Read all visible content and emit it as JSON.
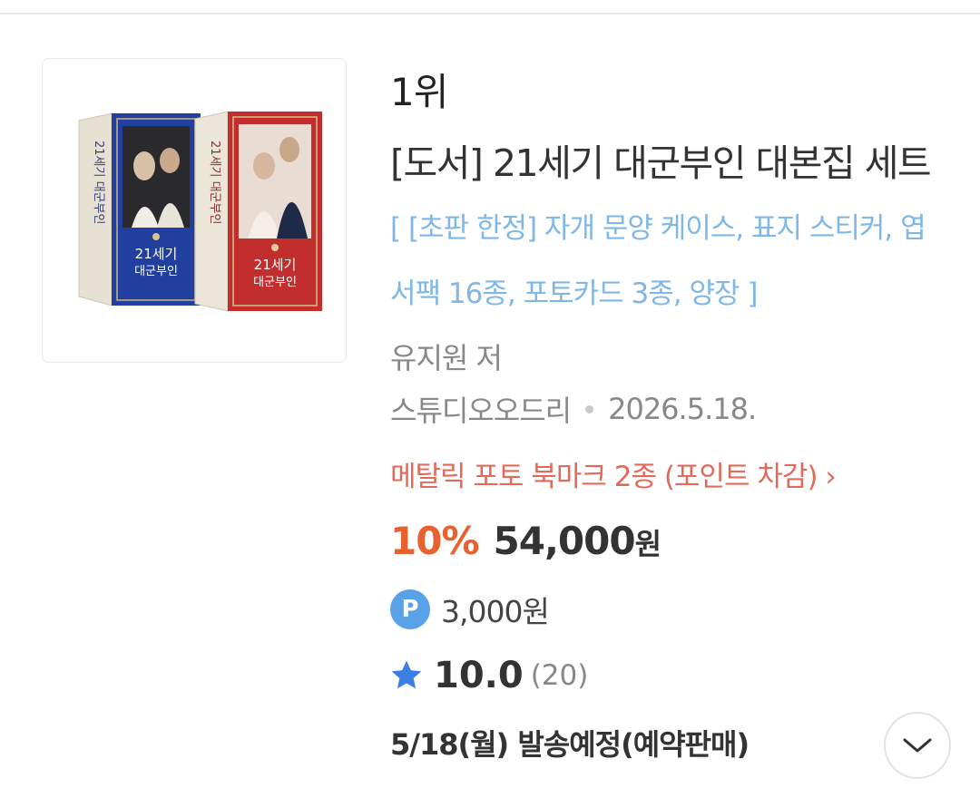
{
  "product": {
    "rank": "1위",
    "title": "[도서] 21세기 대군부인 대본집 세트",
    "subtitle": "[ [초판 한정] 자개 문양 케이스, 표지 스티커, 엽서팩 16종, 포토카드 3종, 양장 ]",
    "cover_text_blue": "21세기 대군부인",
    "cover_text_red": "21세기 대군부인",
    "author": "유지원 저",
    "publisher": "스튜디오오드리",
    "pub_date": "2026.5.18.",
    "promo": "메탈릭 포토 북마크 2종 (포인트 차감) ›",
    "discount": "10%",
    "price": "54,000",
    "price_unit": "원",
    "point_badge": "P",
    "points": "3,000원",
    "rating": "10.0",
    "rating_count": "(20)",
    "shipping": "5/18(월) 발송예정(예약판매)"
  },
  "icons": {
    "star": "star-icon",
    "chevron": "chevron-down-icon",
    "point": "point-icon"
  },
  "colors": {
    "subtitle": "#7fb7e6",
    "promo": "#e06b5b",
    "discount": "#e8622f",
    "point_badge": "#5aa2e8",
    "star": "#3d7fe6"
  }
}
